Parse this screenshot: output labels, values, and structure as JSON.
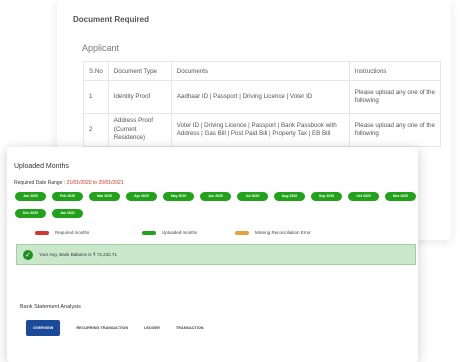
{
  "doc_required": {
    "title": "Document Required",
    "subtitle": "Applicant",
    "headers": [
      "S.No",
      "Document Type",
      "Documents",
      "Instructions"
    ],
    "rows": [
      {
        "sno": "1",
        "type": "Identity Proof",
        "docs": "Aadhaar ID | Passport | Driving Licence | Voter ID",
        "instructions": "Please upload any one of the following"
      },
      {
        "sno": "2",
        "type": "Address Proof (Current Residence)",
        "docs": "Voter ID | Driving Licence | Passport | Bank Passbook with Address | Gas Bill | Post Paid Bill | Property Tax | EB Bill",
        "instructions": "Please upload any one of the following"
      }
    ]
  },
  "uploaded_months": {
    "title": "Uploaded Months",
    "range_label": "Required Date Range :",
    "range_value": "21/01/2020 to 20/01/2021",
    "months": [
      "Jan 2020",
      "Feb 2020",
      "Mar 2020",
      "Apr 2020",
      "May 2020",
      "Jun 2020",
      "Jul 2020",
      "Aug 2020",
      "Sep 2020",
      "Oct 2020",
      "Nov 2020",
      "Dec 2020",
      "Jan 2021"
    ],
    "legend": [
      {
        "label": "Required months",
        "color": "#d93434"
      },
      {
        "label": "Uploaded months",
        "color": "#21a21a"
      },
      {
        "label": "Missing Reconciliation Error",
        "color": "#e6a23c"
      }
    ],
    "balance_text": "Your Avg. Bank Balance is ₹ 72,232.71"
  },
  "analysis": {
    "title": "Bank Statement Analysis",
    "tabs": [
      "OVERVIEW",
      "RECURRING TRANSACTION",
      "LEDGER",
      "TRANSACTION"
    ]
  }
}
